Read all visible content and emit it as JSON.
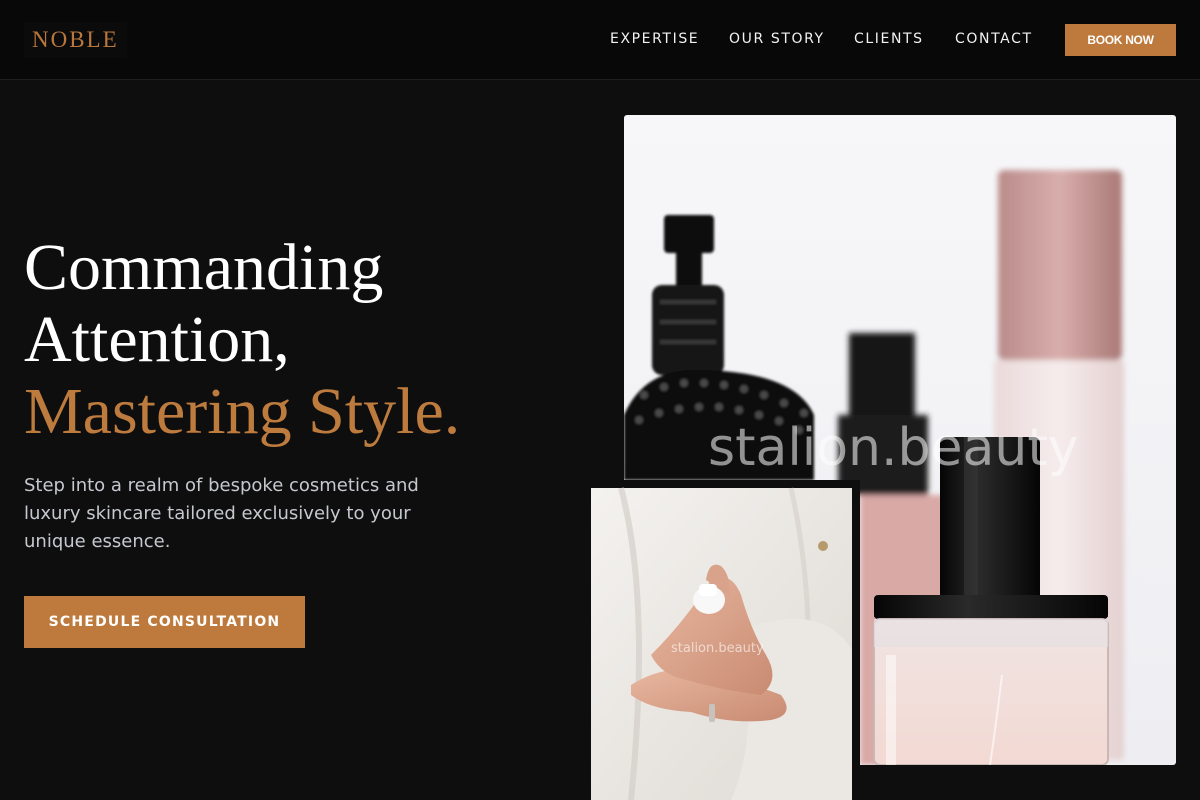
{
  "brand": {
    "logo": "NOBLE"
  },
  "nav": {
    "items": [
      {
        "label": "EXPERTISE"
      },
      {
        "label": "OUR STORY"
      },
      {
        "label": "CLIENTS"
      },
      {
        "label": "CONTACT"
      }
    ],
    "book_label": "BOOK NOW"
  },
  "hero": {
    "title_line1": "Commanding",
    "title_line2": "Attention,",
    "title_accent": "Mastering Style.",
    "subtitle": "Step into a realm of bespoke cosmetics and luxury skincare tailored exclusively to your unique essence.",
    "cta_label": "SCHEDULE CONSULTATION"
  },
  "images": {
    "main_watermark": "stalion.beauty",
    "small_watermark": "stalion.beauty",
    "main_subject": "perfume-bottles-photo",
    "small_subject": "hands-applying-lotion-photo"
  },
  "colors": {
    "accent": "#bd7a3c",
    "background": "#0e0e0e",
    "header_bg": "#080808",
    "text_muted": "#c5c8ce"
  }
}
